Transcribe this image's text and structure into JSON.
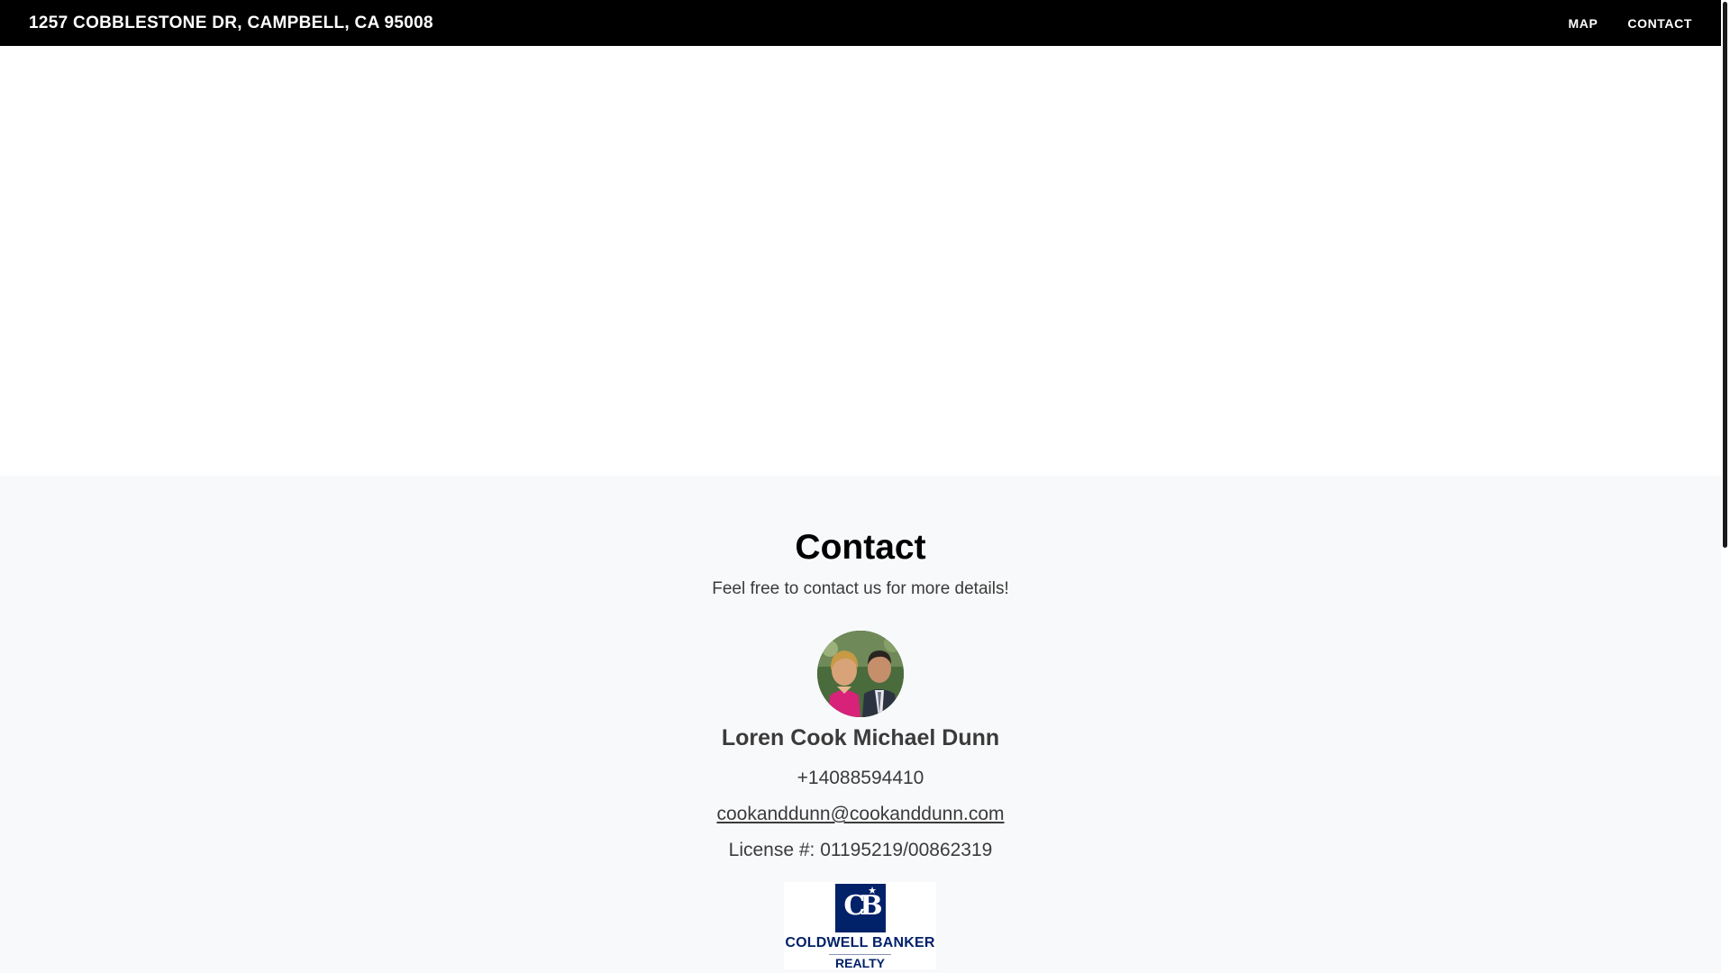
{
  "header": {
    "title": "1257 COBBLESTONE DR, CAMPBELL, CA 95008",
    "nav": [
      {
        "label": "MAP"
      },
      {
        "label": "CONTACT"
      }
    ]
  },
  "contact": {
    "heading": "Contact",
    "subtitle": "Feel free to contact us for more details!",
    "agent": {
      "name": "Loren Cook Michael Dunn",
      "phone": "+14088594410",
      "email": "cookanddunn@cookanddunn.com",
      "license": "License #: 01195219/00862319"
    },
    "brokerage": {
      "mark": "CB",
      "name": "COLDWELL BANKER",
      "sub": "REALTY"
    }
  },
  "colors": {
    "header_bg": "#000000",
    "contact_bg": "#f8f9fb",
    "brand_blue": "#012169"
  },
  "icons": {
    "brokerage_star": "star-icon"
  }
}
